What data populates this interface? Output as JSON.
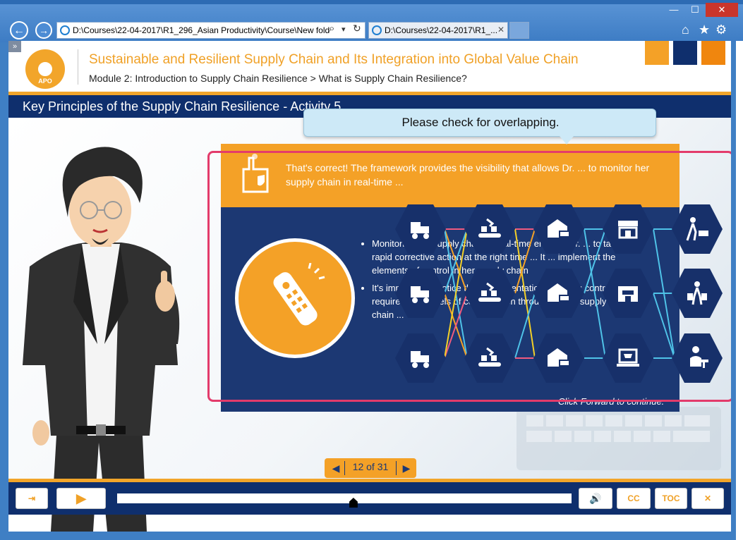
{
  "browser": {
    "address": "D:\\Courses\\22-04-2017\\R1_296_Asian Productivity\\Course\\New fold",
    "tab_title": "D:\\Courses\\22-04-2017\\R1_...",
    "tab_close": "✕",
    "back": "←",
    "forward": "→",
    "search_glyph": "⌕",
    "dropdown_glyph": "▾",
    "refresh_glyph": "↻",
    "home_glyph": "⌂",
    "fav_glyph": "★",
    "settings_glyph": "⚙",
    "minimize": "—",
    "maximize": "☐",
    "close": "✕"
  },
  "header": {
    "logo_text": "APO",
    "title": "Sustainable and Resilient Supply Chain and Its Integration into Global Value Chain",
    "breadcrumb": "Module 2: Introduction to Supply Chain Resilience > What is Supply Chain Resilience?",
    "square_colors": [
      "#f4a127",
      "#0f2f6d",
      "#f0860e"
    ]
  },
  "section": {
    "title": "Key Principles of the Supply Chain Resilience - Activity 5"
  },
  "callout": {
    "text": "Please check for overlapping."
  },
  "card": {
    "top_text": "That's correct! The framework provides the visibility that allows Dr. ... to monitor her supply chain in real-time ...",
    "bullets": [
      "Monitoring the supply chain in real-time enables Dr. ... to take rapid corrective action at the right time ... It ... implement the elements of control in her supply chain",
      "It's important to notice that implementation of strong controls requires high levels of collaboration throughout the supply chain ..."
    ],
    "forward_text": "Click Forward to continue."
  },
  "hexagons": [
    {
      "icon": "forklift-icon"
    },
    {
      "icon": "conveyor-icon"
    },
    {
      "icon": "warehouse-truck-icon"
    },
    {
      "icon": "storefront-icon"
    },
    {
      "icon": "shopper-cart-icon"
    },
    {
      "icon": "forklift-icon"
    },
    {
      "icon": "conveyor-icon"
    },
    {
      "icon": "warehouse-truck-icon"
    },
    {
      "icon": "shop-icon"
    },
    {
      "icon": "shopper-bags-icon"
    },
    {
      "icon": "forklift-icon"
    },
    {
      "icon": "conveyor-icon"
    },
    {
      "icon": "warehouse-truck-icon"
    },
    {
      "icon": "laptop-cart-icon"
    },
    {
      "icon": "online-shopper-icon"
    }
  ],
  "pagination": {
    "label": "12 of 31",
    "prev": "◀",
    "next": "▶",
    "current": 12,
    "total": 31
  },
  "controls": {
    "exit": "⇥",
    "play": "▶",
    "volume": "🔊",
    "cc": "CC",
    "toc": "TOC",
    "close": "✕",
    "progress_fraction": 0.52
  },
  "collapse_glyph": "»"
}
